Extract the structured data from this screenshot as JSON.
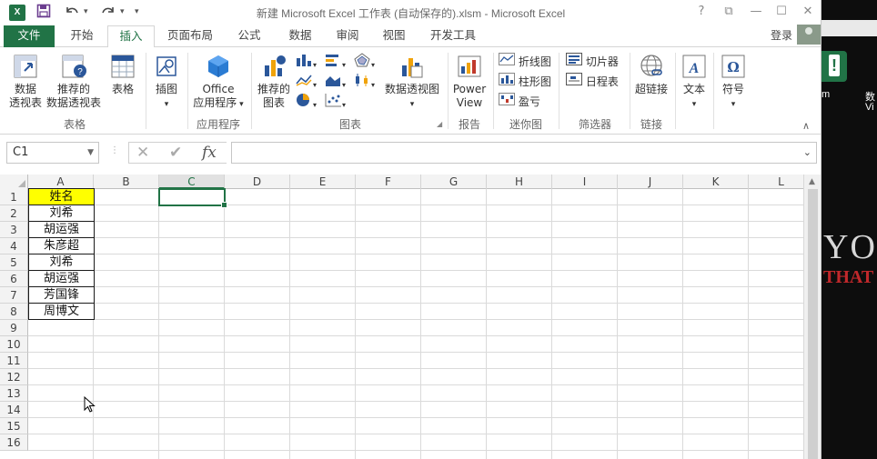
{
  "titlebar": {
    "app_badge": "X",
    "title": "新建 Microsoft Excel 工作表 (自动保存的).xlsm - Microsoft Excel",
    "help": "?",
    "ribbon_display": "⧉",
    "minimize": "—",
    "maximize": "☐",
    "close": "✕"
  },
  "tabs": [
    "文件",
    "开始",
    "插入",
    "页面布局",
    "公式",
    "数据",
    "审阅",
    "视图",
    "开发工具"
  ],
  "account": {
    "signin": "登录"
  },
  "ribbon": {
    "groups": {
      "tables": "表格",
      "apps": "应用程序",
      "charts": "图表",
      "reports": "报告",
      "sparklines": "迷你图",
      "filters": "筛选器",
      "links": "链接"
    },
    "buttons": {
      "pivot_table": [
        "数据",
        "透视表"
      ],
      "recommended_pivot": [
        "推荐的",
        "数据透视表"
      ],
      "table": "表格",
      "illustrations": "插图",
      "office_apps": [
        "Office",
        "应用程序"
      ],
      "recommended_charts": [
        "推荐的",
        "图表"
      ],
      "pivot_chart": "数据透视图",
      "power_view": [
        "Power",
        "View"
      ],
      "spark_line": "折线图",
      "spark_column": "柱形图",
      "spark_winloss": "盈亏",
      "slicer": "切片器",
      "timeline": "日程表",
      "hyperlink": "超链接",
      "text": "文本",
      "symbol": "符号"
    }
  },
  "formula_bar": {
    "name_box": "C1",
    "cancel": "✕",
    "enter": "✔",
    "fx": "fx",
    "value": ""
  },
  "grid": {
    "columns": [
      "A",
      "B",
      "C",
      "D",
      "E",
      "F",
      "G",
      "H",
      "I",
      "J",
      "K",
      "L"
    ],
    "rows": [
      "1",
      "2",
      "3",
      "4",
      "5",
      "6",
      "7",
      "8",
      "9",
      "10",
      "11",
      "12",
      "13",
      "14",
      "15",
      "16"
    ],
    "column_a": [
      "姓名",
      "刘希",
      "胡运强",
      "朱彦超",
      "刘希",
      "胡运强",
      "芳国锋",
      "周博文"
    ],
    "selected_cell": "C1"
  },
  "desktop": {
    "label_1": "m",
    "label_2": "数",
    "label_3": "Vi",
    "poster_top": "YO",
    "poster_bottom": "THAT"
  },
  "colors": {
    "excel_green": "#217346",
    "header_fill": "#ffff00"
  }
}
